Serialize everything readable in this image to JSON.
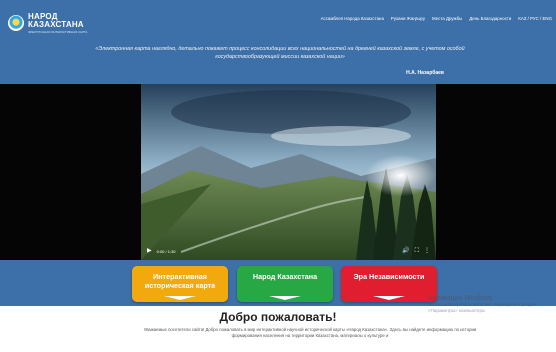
{
  "logo": {
    "title": "НАРОД КАЗАХСТАНА",
    "subtitle": "ЭЛЕКТРОННАЯ ИНТЕРАКТИВНАЯ КАРТА"
  },
  "nav": [
    "Ассамблея Народа Казахстана",
    "Рухани Жаңғыру",
    "Места Дружбы",
    "День Благодарности",
    "КАЗ / РУС / ENG"
  ],
  "quote": {
    "text": "«Электронная карта наглядно, детально покажет процесс консолидации всех национальностей на древней казахской земле, с учетом особой государствообразующей миссии казахской нации»",
    "author": "Н.А. Назарбаев"
  },
  "video": {
    "time": "0:00 / 1:30"
  },
  "cards": [
    {
      "label": "Интерактивная историческая карта",
      "color": "#f2a90e"
    },
    {
      "label": "Народ Казахстана",
      "color": "#27a844"
    },
    {
      "label": "Эра Независимости",
      "color": "#e01e30"
    }
  ],
  "welcome": {
    "title": "Добро пожаловать!",
    "body": "Уважаемые посетители сайта! Добро пожаловать в мир интерактивной научной исторической карты «Народ Казахстана». Здесь вы найдете информацию по истории формирования населения на территории Казахстана, материалы о культуре и"
  },
  "watermark": {
    "title": "Активация Windows",
    "text": "Чтобы активировать Windows, перейдите в раздел «Параметры» компьютера."
  },
  "colors": {
    "header": "#3d6fa8",
    "card_yellow": "#f2a90e",
    "card_green": "#27a844",
    "card_red": "#e01e30"
  }
}
